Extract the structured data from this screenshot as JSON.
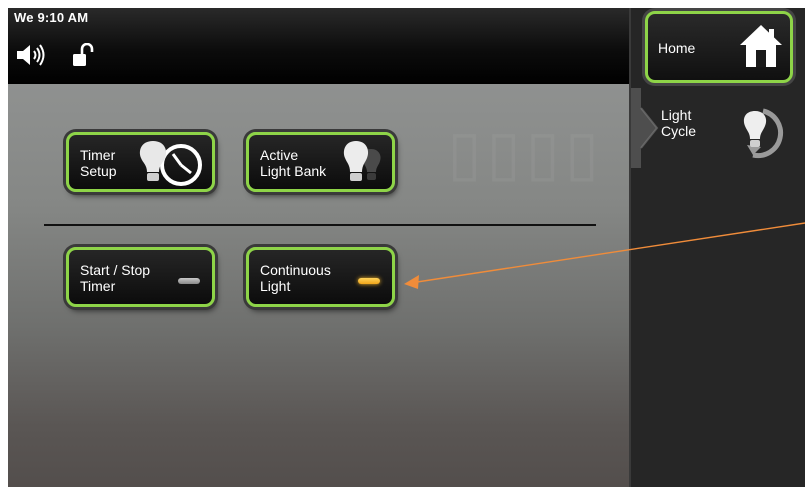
{
  "status": {
    "clock": "We 9:10 AM"
  },
  "buttons": {
    "timer_setup": "Timer\nSetup",
    "active_light_bank": "Active\nLight Bank",
    "start_stop_timer": "Start / Stop\nTimer",
    "continuous_light": "Continuous\nLight"
  },
  "indicators": {
    "start_stop_timer": {
      "state": "off",
      "color": "#9a9a9a"
    },
    "continuous_light": {
      "state": "on",
      "color": "#f5b52a"
    }
  },
  "sidebar": {
    "home_label": "Home",
    "light_cycle_label": "Light\nCycle"
  },
  "colors": {
    "button_border": "#8ed448",
    "annotation_arrow": "#f08c3a"
  }
}
